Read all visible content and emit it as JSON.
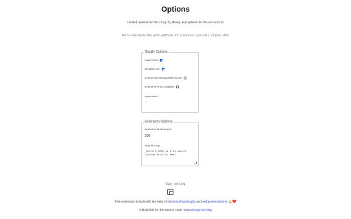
{
  "title": "Options",
  "intro": {
    "part1": "Limited options for the",
    "lib_name": "slugify",
    "part2": "library and options for the",
    "ext_name": "extension"
  },
  "sample_text": "hello-and-here-the-anti-pattern-of-(course)-(juicial)-(love)-char",
  "slugify_options": {
    "legend": "Slugify Options",
    "lowercase": {
      "label": "lowercase",
      "checked": true
    },
    "decamelize": {
      "label": "decamelize",
      "checked": true
    },
    "preserve_leading_underscore": {
      "label": "preserveLeadingUnderscore",
      "checked": false
    },
    "preserve_trailing_dash": {
      "label": "preserveTrailingDash",
      "checked": false
    },
    "separator": {
      "label": "separator",
      "value": "-"
    }
  },
  "extension_options": {
    "legend": "Extension Options",
    "max_selection_length": {
      "label": "maxSelectionLength",
      "value": "200"
    },
    "test_string": {
      "label": "testString",
      "value": "_Hello & 0992 is a JS and of\n(Course fix)? @, Hmm!-"
    }
  },
  "copy_setting": {
    "label": "Copy setting",
    "icon": "copy-icon"
  },
  "footer": {
    "built_prefix": "This extension is built with the help of",
    "link1": "sindresorhus/slugify",
    "and": "and",
    "link2": "webpresentations",
    "emoji": "🙏❤️",
    "source_prefix": "Github link for the source code:",
    "source_link": "wanna/copy-as-slug"
  },
  "colors": {
    "link": "#2a3cd6",
    "checkbox_checked": "#2a62e8"
  }
}
